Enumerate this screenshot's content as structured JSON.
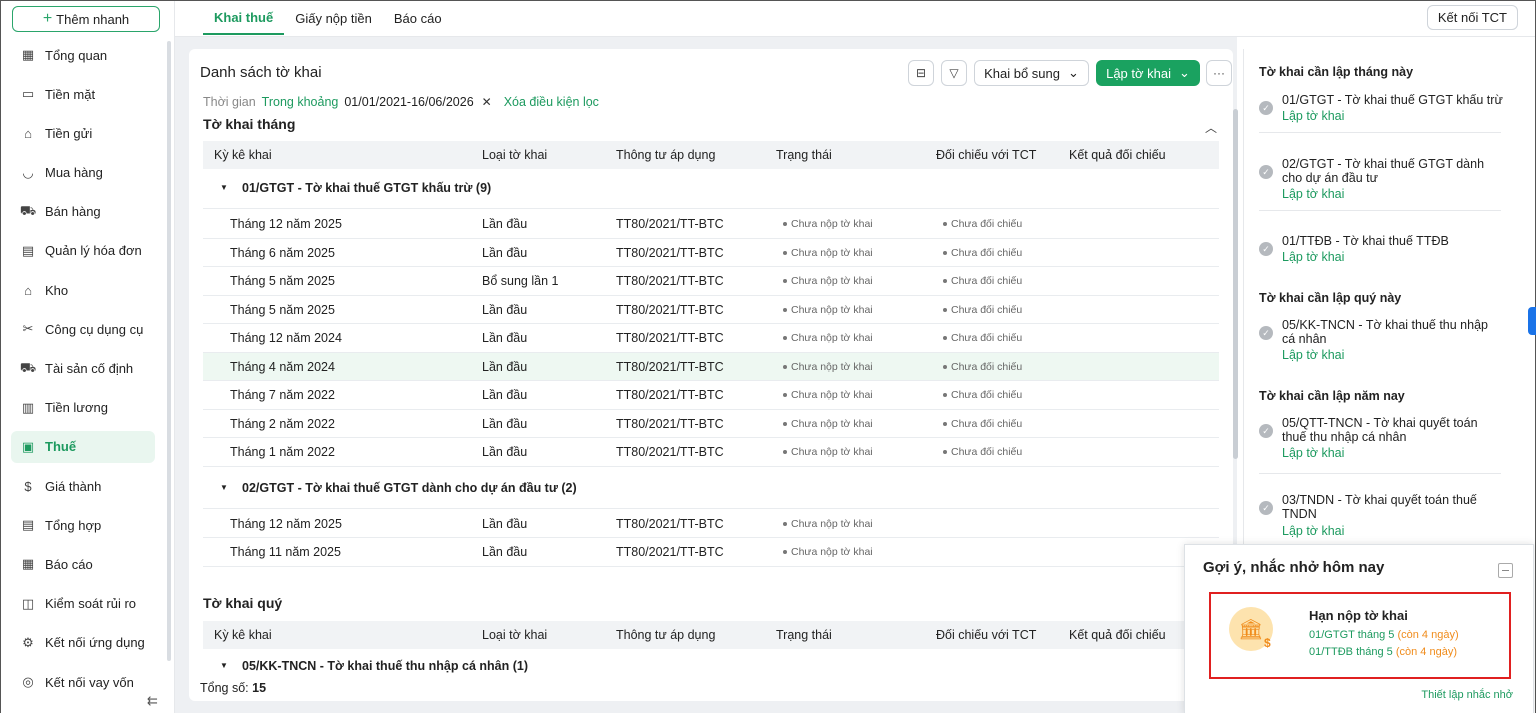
{
  "sidebar": {
    "add_label": "Thêm nhanh",
    "items": [
      {
        "label": "Tổng quan",
        "icon": "grid-icon"
      },
      {
        "label": "Tiền mặt",
        "icon": "cash-icon"
      },
      {
        "label": "Tiền gửi",
        "icon": "bank-icon"
      },
      {
        "label": "Mua hàng",
        "icon": "shopping-bag-icon"
      },
      {
        "label": "Bán hàng",
        "icon": "cart-icon"
      },
      {
        "label": "Quản lý hóa đơn",
        "icon": "invoice-icon"
      },
      {
        "label": "Kho",
        "icon": "warehouse-icon"
      },
      {
        "label": "Công cụ dụng cụ",
        "icon": "tools-icon"
      },
      {
        "label": "Tài sản cố định",
        "icon": "truck-icon"
      },
      {
        "label": "Tiền lương",
        "icon": "payroll-icon"
      },
      {
        "label": "Thuế",
        "icon": "tax-icon"
      },
      {
        "label": "Giá thành",
        "icon": "price-icon"
      },
      {
        "label": "Tổng hợp",
        "icon": "summary-icon"
      },
      {
        "label": "Báo cáo",
        "icon": "report-icon"
      },
      {
        "label": "Kiểm soát rủi ro",
        "icon": "risk-icon"
      },
      {
        "label": "Kết nối ứng dụng",
        "icon": "connect-icon"
      },
      {
        "label": "Kết nối vay vốn",
        "icon": "loan-icon"
      }
    ],
    "active_index": 10
  },
  "topbar": {
    "tabs": [
      "Khai thuế",
      "Giấy nộp tiền",
      "Báo cáo"
    ],
    "connect_label": "Kết nối TCT"
  },
  "main": {
    "title": "Danh sách tờ khai",
    "supplement_label": "Khai bổ sung",
    "create_label": "Lập tờ khai",
    "filter": {
      "label": "Thời gian",
      "mode": "Trong khoảng",
      "range": "01/01/2021-16/06/2026",
      "clear": "Xóa điều kiện lọc"
    },
    "monthly_title": "Tờ khai tháng",
    "quarterly_title": "Tờ khai quý",
    "columns": [
      "Kỳ kê khai",
      "Loại tờ khai",
      "Thông tư áp dụng",
      "Trạng thái",
      "Đối chiếu với TCT",
      "Kết quả đối chiếu"
    ],
    "groups": [
      {
        "title": "01/GTGT - Tờ khai thuế GTGT khấu trừ (9)",
        "rows": [
          [
            "Tháng 12 năm 2025",
            "Lần đầu",
            "TT80/2021/TT-BTC",
            "Chưa nộp tờ khai",
            "Chưa đối chiếu"
          ],
          [
            "Tháng 6 năm 2025",
            "Lần đầu",
            "TT80/2021/TT-BTC",
            "Chưa nộp tờ khai",
            "Chưa đối chiếu"
          ],
          [
            "Tháng 5 năm 2025",
            "Bổ sung lần 1",
            "TT80/2021/TT-BTC",
            "Chưa nộp tờ khai",
            "Chưa đối chiếu"
          ],
          [
            "Tháng 5 năm 2025",
            "Lần đầu",
            "TT80/2021/TT-BTC",
            "Chưa nộp tờ khai",
            "Chưa đối chiếu"
          ],
          [
            "Tháng 12 năm 2024",
            "Lần đầu",
            "TT80/2021/TT-BTC",
            "Chưa nộp tờ khai",
            "Chưa đối chiếu"
          ],
          [
            "Tháng 4 năm 2024",
            "Lần đầu",
            "TT80/2021/TT-BTC",
            "Chưa nộp tờ khai",
            "Chưa đối chiếu"
          ],
          [
            "Tháng 7 năm 2022",
            "Lần đầu",
            "TT80/2021/TT-BTC",
            "Chưa nộp tờ khai",
            "Chưa đối chiếu"
          ],
          [
            "Tháng 2 năm 2022",
            "Lần đầu",
            "TT80/2021/TT-BTC",
            "Chưa nộp tờ khai",
            "Chưa đối chiếu"
          ],
          [
            "Tháng 1 năm 2022",
            "Lần đầu",
            "TT80/2021/TT-BTC",
            "Chưa nộp tờ khai",
            "Chưa đối chiếu"
          ]
        ]
      },
      {
        "title": "02/GTGT - Tờ khai thuế GTGT dành cho dự án đầu tư (2)",
        "rows": [
          [
            "Tháng 12 năm 2025",
            "Lần đầu",
            "TT80/2021/TT-BTC",
            "Chưa nộp tờ khai",
            ""
          ],
          [
            "Tháng 11 năm 2025",
            "Lần đầu",
            "TT80/2021/TT-BTC",
            "Chưa nộp tờ khai",
            ""
          ]
        ]
      }
    ],
    "quarterly_group": "05/KK-TNCN - Tờ khai thuế thu nhập cá nhân (1)",
    "total_label": "Tổng số:",
    "total_value": "15"
  },
  "right_panel": {
    "sections": [
      {
        "title": "Tờ khai cần lập tháng này"
      },
      {
        "title": "Tờ khai cần lập quý này"
      },
      {
        "title": "Tờ khai cần lập năm nay"
      }
    ],
    "link_label": "Lập tờ khai",
    "items": [
      {
        "title": "01/GTGT - Tờ khai thuế GTGT khấu trừ"
      },
      {
        "title": "02/GTGT - Tờ khai thuế GTGT dành cho dự án đầu tư"
      },
      {
        "title": "01/TTĐB - Tờ khai thuế TTĐB"
      },
      {
        "title": "05/KK-TNCN - Tờ khai thuế thu nhập cá nhân"
      },
      {
        "title": "05/QTT-TNCN - Tờ khai quyết toán thuế thu nhập cá nhân"
      },
      {
        "title": "03/TNDN - Tờ khai quyết toán thuế TNDN"
      }
    ]
  },
  "popup": {
    "title": "Gợi ý, nhắc nhở hôm nay",
    "reminder_title": "Hạn nộp tờ khai",
    "lines": [
      {
        "text": "01/GTGT tháng 5",
        "note": "(còn 4 ngày)"
      },
      {
        "text": "01/TTĐB tháng 5",
        "note": "(còn 4 ngày)"
      }
    ],
    "setting_label": "Thiết lập nhắc nhở"
  }
}
